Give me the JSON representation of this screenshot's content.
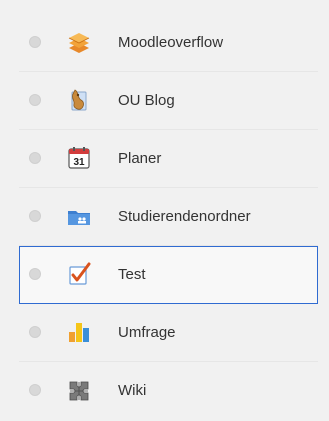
{
  "activity_list": {
    "items": [
      {
        "label": "Moodleoverflow",
        "icon": "moodleoverflow-stack-icon",
        "selected": false
      },
      {
        "label": "OU Blog",
        "icon": "ou-blog-icon",
        "selected": false
      },
      {
        "label": "Planer",
        "icon": "calendar-31-icon",
        "selected": false
      },
      {
        "label": "Studierendenordner",
        "icon": "student-folder-icon",
        "selected": false
      },
      {
        "label": "Test",
        "icon": "quiz-checkmark-icon",
        "selected": true
      },
      {
        "label": "Umfrage",
        "icon": "survey-bar-chart-icon",
        "selected": false
      },
      {
        "label": "Wiki",
        "icon": "wiki-puzzle-icon",
        "selected": false
      }
    ],
    "calendar_day": "31"
  },
  "colors": {
    "selection_border": "#2f6bd1",
    "text": "#333333",
    "panel_background": "#f1f1f1"
  }
}
